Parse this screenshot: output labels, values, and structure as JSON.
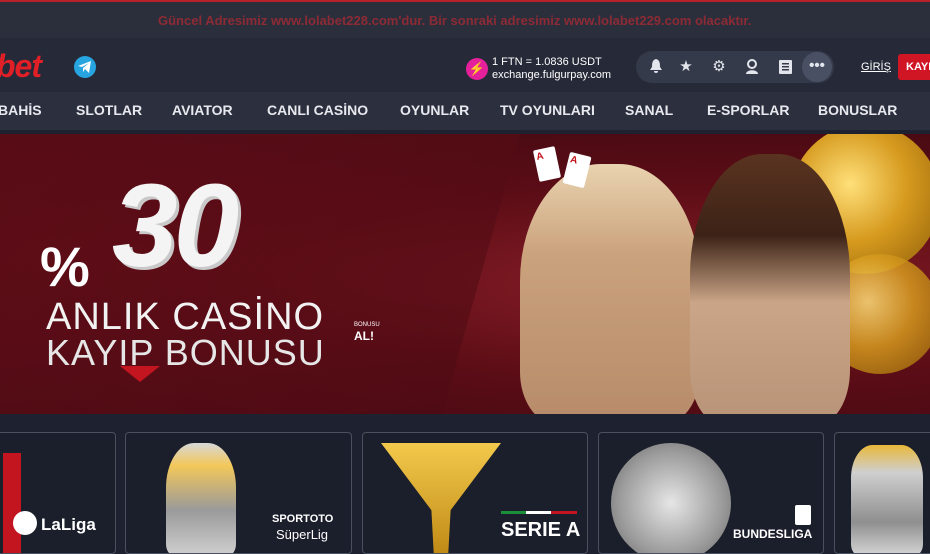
{
  "announcement": "Güncel Adresimiz www.lolabet228.com'dur. Bir sonraki adresimiz www.lolabet229.com olacaktır.",
  "header": {
    "logo": "bet",
    "rate": {
      "line1": "1 FTN = 1.0836 USDT",
      "line2": "exchange.fulgurpay.com"
    },
    "icons": [
      "bell-icon",
      "star-icon",
      "gear-icon",
      "user-icon",
      "list-icon",
      "more-icon"
    ],
    "more": "•••",
    "login": "GİRİŞ",
    "register": "KAYIT"
  },
  "nav": [
    "BAHİS",
    "SLOTLAR",
    "AVIATOR",
    "CANLI CASİNO",
    "OYUNLAR",
    "TV OYUNLARI",
    "SANAL",
    "E-SPORLAR",
    "BONUSLAR"
  ],
  "banner": {
    "percent_sign": "%",
    "amount": "30",
    "line1": "ANLIK CASİNO",
    "line2": "KAYIP BONUSU",
    "cta_small": "BONUSU",
    "cta": "AL!",
    "card_marks": [
      "A",
      "A"
    ]
  },
  "tiles": [
    {
      "label": "LaLiga"
    },
    {
      "label1": "SPORTOTO",
      "label2": "SüperLig"
    },
    {
      "label": "SERIE A"
    },
    {
      "label": "BUNDESLIGA"
    },
    {
      "label": ""
    }
  ],
  "colors": {
    "brand_red": "#e11f27",
    "accent_pink": "#e4209a",
    "bg": "#1e2130"
  }
}
